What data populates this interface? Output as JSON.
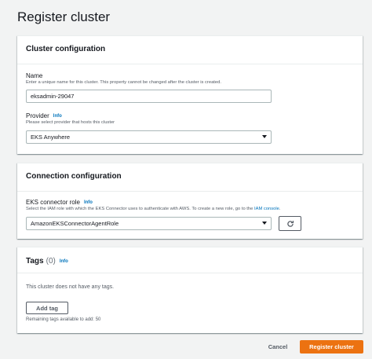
{
  "page_title": "Register cluster",
  "cluster_config": {
    "title": "Cluster configuration",
    "name_label": "Name",
    "name_desc": "Enter a unique name for this cluster. This property cannot be changed after the cluster is created.",
    "name_value": "eksadmin-29047",
    "provider_label": "Provider",
    "provider_info": "Info",
    "provider_desc": "Please select provider that hosts this cluster",
    "provider_value": "EKS Anywhere"
  },
  "connection_config": {
    "title": "Connection configuration",
    "role_label": "EKS connector role",
    "role_info": "Info",
    "role_desc": "Select the IAM role with which the EKS Connector uses to authenticate with AWS. To create a new role, go to the",
    "role_desc_link": "IAM console",
    "role_desc_end": ".",
    "role_value": "AmazonEKSConnectorAgentRole",
    "refresh_icon": "refresh-icon"
  },
  "tags": {
    "title": "Tags",
    "count": "(0)",
    "info": "Info",
    "empty_text": "This cluster does not have any tags.",
    "add_tag_label": "Add tag",
    "remaining_text": "Remaining tags available to add: 50"
  },
  "footer": {
    "cancel_label": "Cancel",
    "register_label": "Register cluster"
  },
  "colors": {
    "accent": "#ec7211",
    "link": "#0073bb",
    "background": "#f2f3f3"
  }
}
